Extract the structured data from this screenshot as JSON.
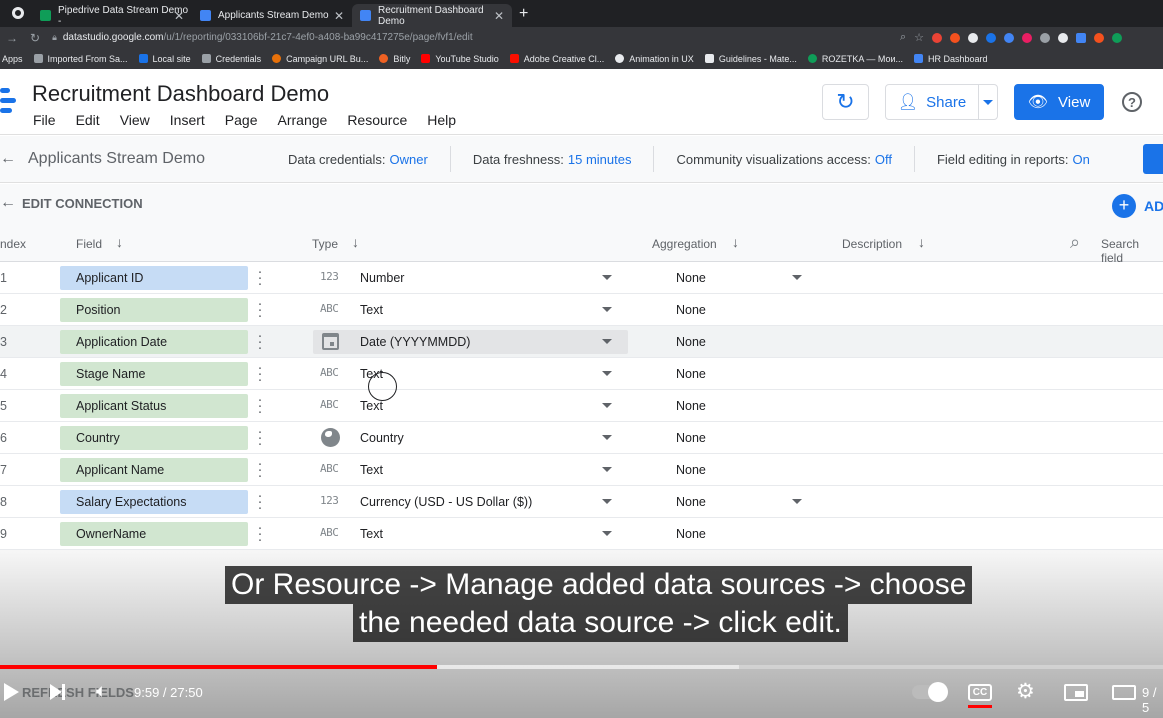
{
  "browser": {
    "tabs": [
      {
        "title": "Pipedrive Data Stream Demo -",
        "color": "#0f9d58",
        "active": false
      },
      {
        "title": "Applicants Stream Demo",
        "color": "#4285f4",
        "active": false
      },
      {
        "title": "Recruitment Dashboard Demo",
        "color": "#4285f4",
        "active": true
      }
    ],
    "new_tab": "+",
    "url_host": "datastudio.google.com",
    "url_path": "/u/1/reporting/033106bf-21c7-4ef0-a408-ba99c417275e/page/fvf1/edit",
    "bookmarks": [
      "Apps",
      "Imported From Sa...",
      "Local site",
      "Credentials",
      "Campaign URL Bu...",
      "Bitly",
      "YouTube Studio",
      "Adobe Creative Cl...",
      "Animation in UX",
      "Guidelines - Mate...",
      "ROZETKA — Мои...",
      "HR Dashboard"
    ]
  },
  "app": {
    "title": "Recruitment Dashboard Demo",
    "menus": [
      "File",
      "Edit",
      "View",
      "Insert",
      "Page",
      "Arrange",
      "Resource",
      "Help"
    ],
    "share_label": "Share",
    "view_label": "View",
    "help_glyph": "?"
  },
  "datasource": {
    "name": "Applicants Stream Demo",
    "credentials_label": "Data credentials:",
    "credentials_value": "Owner",
    "freshness_label": "Data freshness:",
    "freshness_value": "15 minutes",
    "community_label": "Community visualizations access:",
    "community_value": "Off",
    "field_edit_label": "Field editing in reports:",
    "field_edit_value": "On"
  },
  "edit_connection": {
    "label": "EDIT CONNECTION",
    "add_label": "AD"
  },
  "table": {
    "headers": {
      "index": "ndex",
      "field": "Field",
      "type": "Type",
      "aggregation": "Aggregation",
      "description": "Description"
    },
    "search_placeholder": "Search field",
    "rows": [
      {
        "index": "1",
        "field": "Applicant ID",
        "kind": "met",
        "type_icon": "123",
        "type": "Number",
        "aggregation": "None",
        "agg_dropdown": true,
        "highlight": false
      },
      {
        "index": "2",
        "field": "Position",
        "kind": "dim",
        "type_icon": "ABC",
        "type": "Text",
        "aggregation": "None",
        "agg_dropdown": false,
        "highlight": false
      },
      {
        "index": "3",
        "field": "Application Date",
        "kind": "dim",
        "type_icon": "calendar",
        "type": "Date (YYYYMMDD)",
        "aggregation": "None",
        "agg_dropdown": false,
        "highlight": true
      },
      {
        "index": "4",
        "field": "Stage Name",
        "kind": "dim",
        "type_icon": "ABC",
        "type": "Text",
        "aggregation": "None",
        "agg_dropdown": false,
        "highlight": false
      },
      {
        "index": "5",
        "field": "Applicant Status",
        "kind": "dim",
        "type_icon": "ABC",
        "type": "Text",
        "aggregation": "None",
        "agg_dropdown": false,
        "highlight": false
      },
      {
        "index": "6",
        "field": "Country",
        "kind": "dim",
        "type_icon": "globe",
        "type": "Country",
        "aggregation": "None",
        "agg_dropdown": false,
        "highlight": false
      },
      {
        "index": "7",
        "field": "Applicant Name",
        "kind": "dim",
        "type_icon": "ABC",
        "type": "Text",
        "aggregation": "None",
        "agg_dropdown": false,
        "highlight": false
      },
      {
        "index": "8",
        "field": "Salary Expectations",
        "kind": "met",
        "type_icon": "123",
        "type": "Currency (USD - US Dollar ($))",
        "aggregation": "None",
        "agg_dropdown": true,
        "highlight": false
      },
      {
        "index": "9",
        "field": "OwnerName",
        "kind": "dim",
        "type_icon": "ABC",
        "type": "Text",
        "aggregation": "None",
        "agg_dropdown": false,
        "highlight": false
      }
    ]
  },
  "video": {
    "caption_line1": "Or Resource -> Manage added data sources -> choose",
    "caption_line2": "the needed data source -> click edit.",
    "time": "9:59 / 27:50",
    "behind_text": "REFRESH FIELDS",
    "chapter": "9 / 5",
    "progress_played": 0.376,
    "progress_buffered": 0.635
  }
}
